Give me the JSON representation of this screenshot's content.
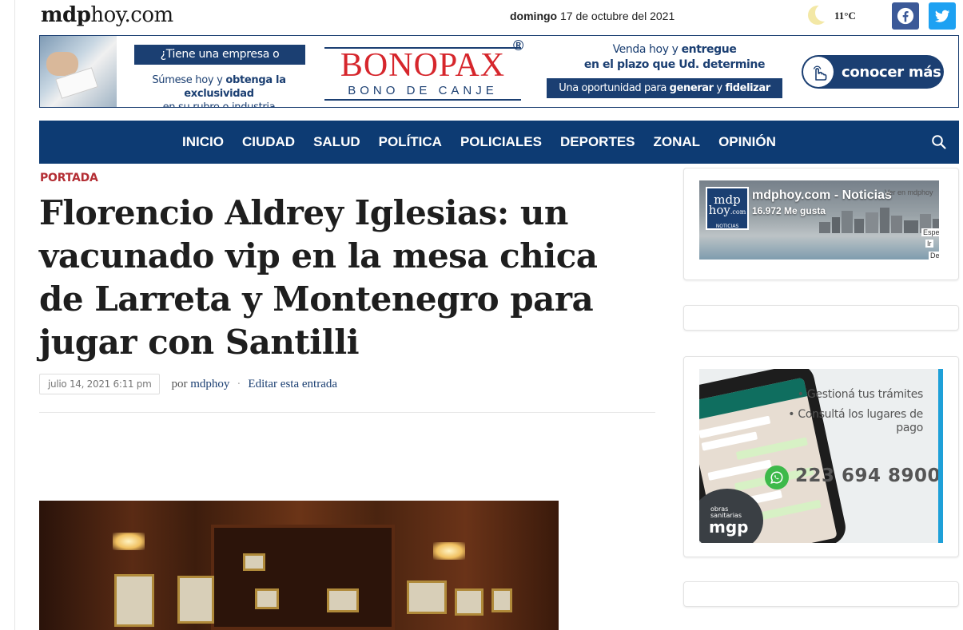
{
  "site": {
    "logo_bold": "mdp",
    "logo_regular": "hoy",
    "logo_suffix": ".com",
    "day": "domingo",
    "date": " 17 de octubre del 2021",
    "temperature": "11°C"
  },
  "social": {
    "facebook_icon": "facebook-icon",
    "twitter_icon": "twitter-icon",
    "facebook_color": "#3b5998",
    "twitter_color": "#1da1f2"
  },
  "banner": {
    "question": "¿Tiene una empresa o comercio?",
    "sub_line1_pre": "Súmese hoy y ",
    "sub_line1_bold": "obtenga la exclusividad",
    "sub_line2": "en su rubro o industria",
    "brand": "BONOPAX",
    "brand_reg": "®",
    "brand_sub": "BONO DE CANJE",
    "right_line1_pre": "Venda hoy y ",
    "right_line1_bold": "entregue",
    "right_line2": "en el plazo que Ud. determine",
    "right_box_pre": "Una oportunidad para ",
    "right_box_bold1": "generar",
    "right_box_mid": " y ",
    "right_box_bold2": "fidelizar clientes",
    "cta": "conocer más"
  },
  "nav": {
    "items": [
      "INICIO",
      "CIUDAD",
      "SALUD",
      "POLÍTICA",
      "POLICIALES",
      "DEPORTES",
      "ZONAL",
      "OPINIÓN"
    ],
    "search_icon": "search-icon",
    "background": "#0d3b73"
  },
  "article": {
    "category": "PORTADA",
    "title": "Florencio Aldrey Iglesias: un vacunado vip en la mesa chica de Larreta y Montenegro para jugar con Santilli",
    "date": "julio 14, 2021 6:11 pm",
    "by": "por",
    "author": "mdphoy",
    "separator": "·",
    "edit": "Editar esta entrada",
    "category_color": "#b42e34"
  },
  "sidebar": {
    "fb_page_name": "mdphoy.com - Noticias",
    "fb_likes": "16.972 Me gusta",
    "fb_logo_top": "mdp",
    "fb_logo_bottom": "hoy",
    "fb_logo_suffix": ".com",
    "fb_logo_small": "NOTICIAS",
    "fb_crop_text": "Ver en mdphoy",
    "fb_crop_2": "Espec",
    "fb_crop_3": "Ir",
    "fb_crop_4": "De",
    "osm_line1": "• Gestioná tus trámites",
    "osm_line2": "• Consultá los lugares de pago",
    "osm_phone": "223 694 8900",
    "osm_org_small": "obras sanitarias",
    "osm_org": "mgp"
  }
}
